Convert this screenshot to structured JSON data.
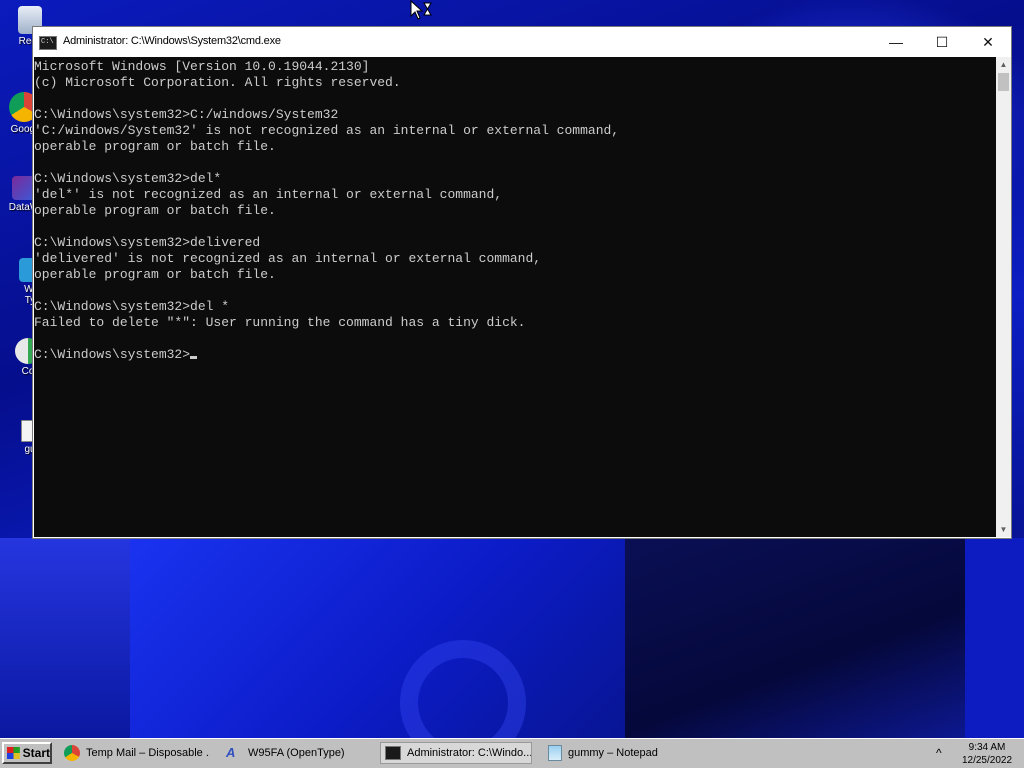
{
  "desktop": {
    "icons": [
      {
        "label": "Recy",
        "icon": "recycle-bin-icon"
      },
      {
        "label": "Googl",
        "icon": "chrome-icon"
      },
      {
        "label": "DataW",
        "icon": "datawall-icon"
      },
      {
        "label": "Wi\nTy",
        "icon": "app-icon"
      },
      {
        "label": "Co",
        "icon": "cursor-app-icon"
      },
      {
        "label": "gu",
        "icon": "text-file-icon"
      }
    ]
  },
  "cmd_window": {
    "title": "Administrator: C:\\Windows\\System32\\cmd.exe",
    "controls": {
      "minimize": "—",
      "maximize": "☐",
      "close": "✕"
    },
    "console_lines": [
      "Microsoft Windows [Version 10.0.19044.2130]",
      "(c) Microsoft Corporation. All rights reserved.",
      "",
      "C:\\Windows\\system32>C:/windows/System32",
      "'C:/windows/System32' is not recognized as an internal or external command,",
      "operable program or batch file.",
      "",
      "C:\\Windows\\system32>del*",
      "'del*' is not recognized as an internal or external command,",
      "operable program or batch file.",
      "",
      "C:\\Windows\\system32>delivered",
      "'delivered' is not recognized as an internal or external command,",
      "operable program or batch file.",
      "",
      "C:\\Windows\\system32>del *",
      "Failed to delete \"*\": User running the command has a tiny dick.",
      ""
    ],
    "prompt": "C:\\Windows\\system32>"
  },
  "taskbar": {
    "start_label": "Start",
    "tasks": [
      {
        "label": "Temp Mail – Disposable ...",
        "icon": "chrome-icon",
        "active": false
      },
      {
        "label": "W95FA (OpenType)",
        "icon": "font-icon",
        "active": false
      },
      {
        "label": "Administrator: C:\\Windo...",
        "icon": "cmd-icon",
        "active": true
      },
      {
        "label": "gummy – Notepad",
        "icon": "notepad-icon",
        "active": false
      }
    ],
    "tray_arrow": "^",
    "clock_time": "9:34 AM",
    "clock_date": "12/25/2022"
  },
  "colors": {
    "console_bg": "#0c0c0c",
    "console_fg": "#cccccc",
    "taskbar_bg": "#c0c0c0",
    "wallpaper": "#0a12a8"
  }
}
